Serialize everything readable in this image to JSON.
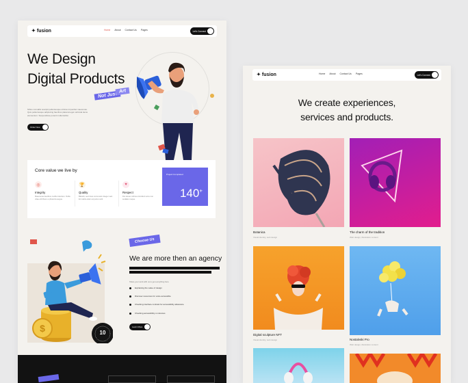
{
  "left_page": {
    "nav": {
      "logo": "fusion",
      "items": [
        "Home",
        "About",
        "Contact Us",
        "Pages"
      ],
      "cta": "Let's Connect"
    },
    "hero": {
      "title_line1": "We Design",
      "title_line2": "Digital Products",
      "description": "Nibus convallis suscipit pellentesque ultrices imperdiet maecenas. Quis pellentesque adipiscing faucibus placerat eget vehicula lacus elementum. Suspendisse potenti nulla facilisi.",
      "button": "Order Now",
      "tag1": "Not Just",
      "tag2": "Art"
    },
    "values": {
      "title": "Core value we live by",
      "items": [
        {
          "label": "Integrity",
          "desc": "Maecenas faucibus mollis interdum. Nulla vitae elit libero a pharetra augue.",
          "color": "#e0564b"
        },
        {
          "label": "Quality",
          "desc": "Blandit, sed risus commodo integer sed. Et mattis etiam at purus velit.",
          "color": "#d4a02a"
        },
        {
          "label": "Respect",
          "desc": "Dui donec ultrices tincidunt arcu non sodales neque.",
          "color": "#e05a78"
        }
      ],
      "project_label": "Project Completed",
      "project_count": "140",
      "project_suffix": "+"
    },
    "agency": {
      "tag": "Choose Us",
      "title": "We are more then an agency",
      "small": "Share your work with us to get everything here",
      "checklist": [
        "Explaining the value of design",
        "Discover resources for voice accessible",
        "Checking interface contrast for accessibility allowance",
        "Checking accessibility on devices"
      ],
      "button": "Learn More",
      "badge_number": "10"
    }
  },
  "right_page": {
    "nav": {
      "logo": "fusion",
      "items": [
        "Home",
        "About",
        "Contact Us",
        "Pages"
      ],
      "cta": "Let's Connect"
    },
    "title_line1": "We create experiences,",
    "title_line2": "services and products.",
    "tiles": [
      {
        "title": "Botanica",
        "sub": "Visual identity, web design"
      },
      {
        "title": "The charm of the tradition",
        "sub": "Web design, illustration content"
      },
      {
        "title": "Digital sculpture NFT",
        "sub": "Visual identity, web design"
      },
      {
        "title": "Nostalvski Pro",
        "sub": "Web design, illustration content"
      }
    ]
  },
  "colors": {
    "accent": "#6a67e8",
    "background": "#f4f2ee",
    "dark": "#121212"
  }
}
